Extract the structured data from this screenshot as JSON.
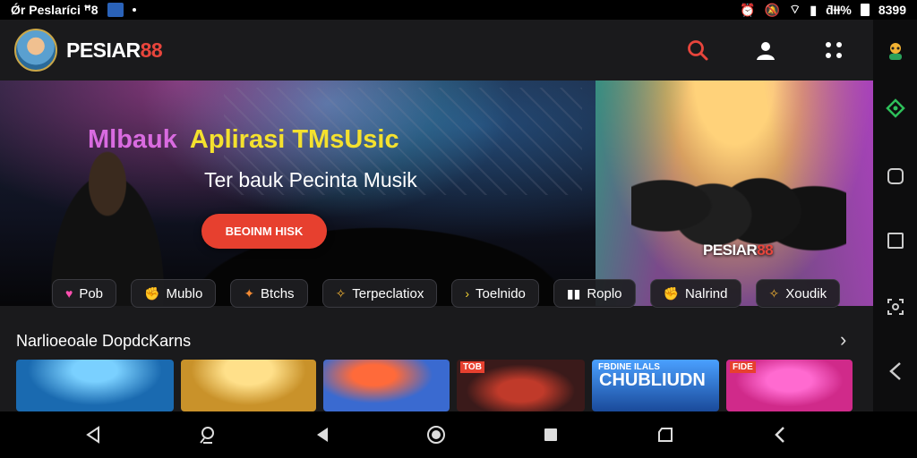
{
  "status_bar": {
    "left_text": "Ǿr Peslaríci ꟸ8",
    "right_text": "ƌƗƗ%",
    "time": "8399"
  },
  "header": {
    "brand_main": "PESIAR",
    "brand_accent": "88",
    "icons": [
      "search-icon",
      "user-icon",
      "grid-icon"
    ]
  },
  "hero": {
    "title_1": "Mlbauk",
    "title_2": "Aplirasi TMsUsic",
    "subtitle": "Ter bauk Pecinta Musik",
    "cta_label": "BEOINM HISK",
    "band_logo_main": "PESIAR",
    "band_logo_accent": "88"
  },
  "genres": [
    {
      "label": "Pob",
      "icon": "heart-icon",
      "color": "#ff4fb0"
    },
    {
      "label": "Mublo",
      "icon": "hand-icon",
      "color": "#f2b233"
    },
    {
      "label": "Btchs",
      "icon": "puzzle-icon",
      "color": "#f28a33"
    },
    {
      "label": "Terpeclatiox",
      "icon": "sparkle-icon",
      "color": "#f2b233"
    },
    {
      "label": "Toelnido",
      "icon": "chevron-icon",
      "color": "#f2d233"
    },
    {
      "label": "Roplo",
      "icon": "bars-icon",
      "color": "#ffffff"
    },
    {
      "label": "Nalrind",
      "icon": "hand-icon",
      "color": "#f2b233"
    },
    {
      "label": "Xoudik",
      "icon": "sparkle-icon",
      "color": "#f2b233"
    }
  ],
  "section": {
    "title": "Narlioeoale DopdcKarns"
  },
  "cards": [
    {
      "badge": "",
      "big": "",
      "bg": "#1a6ab0"
    },
    {
      "badge": "",
      "big": "",
      "bg": "#c9922a"
    },
    {
      "badge": "",
      "big": "",
      "bg": "#3a6ad0"
    },
    {
      "badge": "TOB",
      "big": "",
      "bg": "#3a1a1a"
    },
    {
      "badge": "FBDINE ILALS",
      "big": "CHUBLIUDN",
      "bg": "#2a6ac0"
    },
    {
      "badge": "FIDE",
      "big": "",
      "bg": "#d02a8a"
    }
  ],
  "side_nav": [
    "profile-icon",
    "location-icon",
    "square-icon",
    "square-icon",
    "screenshot-icon",
    "back-chevron-icon"
  ],
  "bottom_nav": [
    "back-triangle-icon",
    "assistant-icon",
    "play-back-icon",
    "home-circle-icon",
    "stop-square-icon",
    "shape-icon",
    "back-chevron-icon"
  ]
}
